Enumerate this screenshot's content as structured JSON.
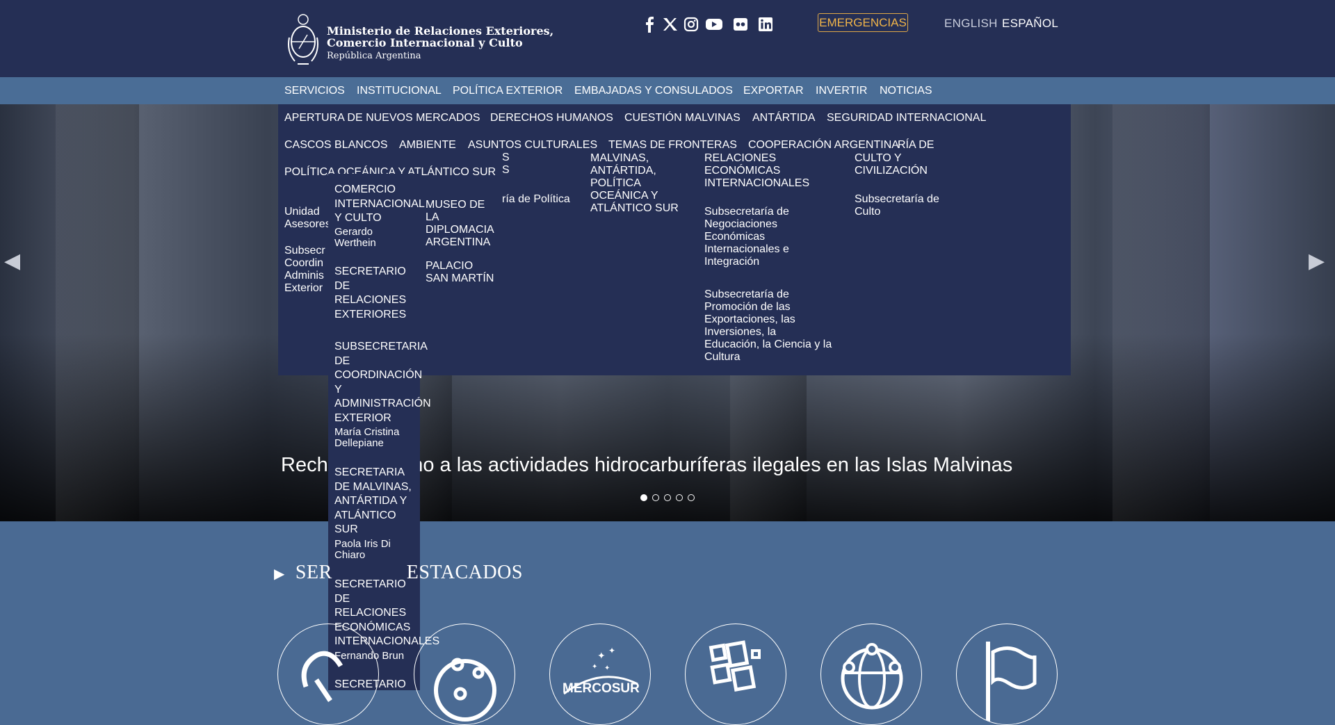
{
  "header": {
    "logo_line1": "Ministerio de Relaciones Exteriores,",
    "logo_line2": "Comercio Internacional y Culto",
    "logo_line3": "República Argentina",
    "social_icons": [
      "facebook-icon",
      "x-icon",
      "instagram-icon",
      "youtube-icon",
      "flickr-icon",
      "linkedin-icon"
    ],
    "emergencias": "EMERGENCIAS",
    "lang_en": "ENGLISH",
    "lang_es": "ESPAÑOL",
    "accent": "#f0b449"
  },
  "nav": [
    "SERVICIOS",
    "INSTITUCIONAL",
    "POLÍTICA EXTERIOR",
    "EMBAJADAS Y CONSULADOS",
    "EXPORTAR",
    "INVERTIR",
    "NOTICIAS"
  ],
  "dropdown": {
    "row1": [
      "APERTURA DE NUEVOS MERCADOS",
      "DERECHOS HUMANOS",
      "CUESTIÓN MALVINAS",
      "ANTÁRTIDA",
      "SEGURIDAD INTERNACIONAL"
    ],
    "row2": [
      "CASCOS BLANCOS",
      "AMBIENTE",
      "ASUNTOS CULTURALES",
      "TEMAS DE FRONTERAS",
      "COOPERACIÓN ARGENTINA"
    ],
    "row2_partial": "RÍA DE",
    "row3": [
      "POLÍTICA OCEÁNICA Y ATLÁNTICO SUR"
    ],
    "col_a_1": "Unidad",
    "col_a_2": "Asesores",
    "col_a_3": "Subsecr",
    "col_a_4": "Coordin",
    "col_a_5": "Adminis",
    "col_a_6": "Exterior",
    "col_b_1": "MUSEO DE",
    "col_b_2": "LA",
    "col_b_3": "DIPLOMACIA",
    "col_b_4": "ARGENTINA",
    "col_b_5": "PALACIO",
    "col_b_6": "SAN MARTÍN",
    "col_c_1": "S",
    "col_c_2": "S",
    "col_c_3": "ría de Política",
    "col_d_1": "MALVINAS,",
    "col_d_2": "ANTÁRTIDA,",
    "col_d_3": "POLÍTICA",
    "col_d_4": "OCEÁNICA Y",
    "col_d_5": "ATLÁNTICO SUR",
    "col_e_1": "RELACIONES",
    "col_e_2": "ECONÓMICAS",
    "col_e_3": "INTERNACIONALES",
    "col_e_sub1": [
      "Subsecretaría de",
      "Negociaciones",
      "Económicas",
      "Internacionales e",
      "Integración"
    ],
    "col_e_sub2": [
      "Subsecretaría de",
      "Promoción de las",
      "Exportaciones, las",
      "Inversiones, la",
      "Educación, la Ciencia y la",
      "Cultura"
    ],
    "col_f_1": "CULTO Y",
    "col_f_2": "CIVILIZACIÓN",
    "col_f_sub": [
      "Subsecretaría de",
      "Culto"
    ]
  },
  "vcol": {
    "t1": [
      "COMERCIO",
      "INTERNACIONAL",
      "Y CULTO"
    ],
    "p1": [
      "Gerardo",
      "Werthein"
    ],
    "t2": [
      "SECRETARIO",
      "DE",
      "RELACIONES",
      "EXTERIORES"
    ],
    "t3": [
      "SUBSECRETARIA",
      "DE",
      "COORDINACIÓN",
      "Y",
      "ADMINISTRACIÓN",
      "EXTERIOR"
    ],
    "p3": [
      "María Cristina",
      "Dellepiane"
    ],
    "t4": [
      "SECRETARIA",
      "DE MALVINAS,",
      "ANTÁRTIDA Y",
      "ATLÁNTICO",
      "SUR"
    ],
    "p4": [
      "Paola Iris Di",
      "Chiaro"
    ],
    "t5": [
      "SECRETARIO",
      "DE",
      "RELACIONES",
      "ECONÓMICAS",
      "INTERNACIONALES"
    ],
    "p5": [
      "Fernando Brun"
    ],
    "t6": [
      "SECRETARIO"
    ]
  },
  "hero": {
    "title": "Rechazo argentino a las actividades hidrocarburíferas ilegales en las Islas Malvinas",
    "visible_title_start": "Rech",
    "visible_title_end": "tino a las actividades hidrocarburíferas ilegales en las Islas Malvinas",
    "slides": 5,
    "active_slide": 1,
    "prev_icon": "chevron-left-icon",
    "next_icon": "chevron-right-icon"
  },
  "section": {
    "title_start": "SER",
    "title_end": "ESTACADOS",
    "marker_icon": "triangle-right-icon",
    "mercosur_label": "MERCOSUR",
    "circles": [
      "document-icon",
      "globe-pins-icon",
      "mercosur-icon",
      "grid-icon",
      "globe-network-icon",
      "flag-icon"
    ]
  }
}
